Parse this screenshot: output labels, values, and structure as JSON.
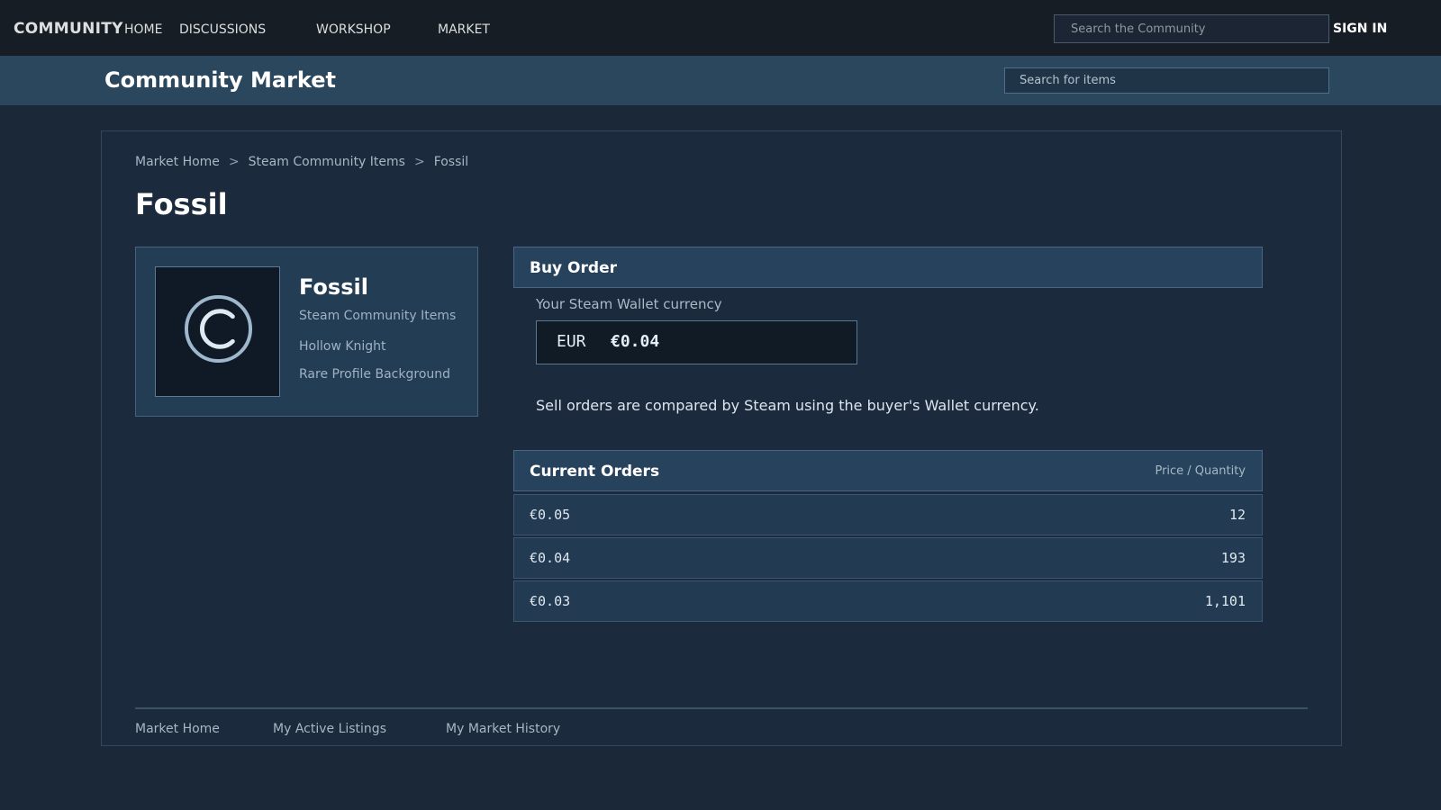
{
  "topnav": {
    "brand": "COMMUNITY",
    "links": [
      "HOME",
      "DISCUSSIONS",
      "WORKSHOP",
      "MARKET"
    ],
    "search_placeholder": "Search the Community",
    "signin": "SIGN IN"
  },
  "market": {
    "title": "Community Market",
    "search_placeholder": "Search for items"
  },
  "breadcrumb": {
    "items": [
      "Market Home",
      "Steam Community Items",
      "Fossil"
    ],
    "separator": ">"
  },
  "page_title": "Fossil",
  "item": {
    "name": "Fossil",
    "category": "Steam Community Items",
    "game": "Hollow Knight",
    "type": "Rare Profile Background",
    "icon": "copyright-icon"
  },
  "buy_order": {
    "header": "Buy Order",
    "wallet_label": "Your Steam Wallet currency",
    "currency": "EUR",
    "amount": "€0.04",
    "note": "Sell orders are compared by Steam using the buyer's Wallet currency."
  },
  "orders": {
    "header": "Current Orders",
    "column_label": "Price / Quantity",
    "rows": [
      {
        "price": "€0.05",
        "quantity": "12"
      },
      {
        "price": "€0.04",
        "quantity": "193"
      },
      {
        "price": "€0.03",
        "quantity": "1,101"
      }
    ]
  },
  "footer": {
    "links": [
      "Market Home",
      "My Active Listings",
      "My Market History"
    ]
  },
  "colors": {
    "background": "#1b2838",
    "topnav": "#171d25",
    "market_bar": "#2a475e",
    "panel": "#1b2a3c",
    "section_header": "#27425c"
  }
}
